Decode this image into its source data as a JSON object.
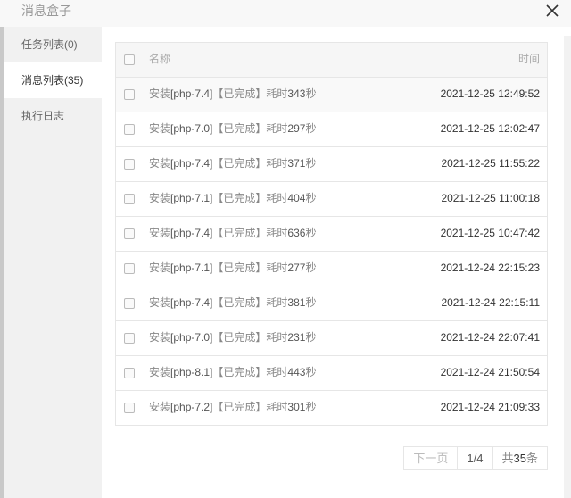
{
  "dialog": {
    "title": "消息盒子",
    "close_icon": "close-icon"
  },
  "sidebar": {
    "items": [
      {
        "label": "任务列表",
        "count": "(0)",
        "active": false
      },
      {
        "label": "消息列表",
        "count": "(35)",
        "active": true
      },
      {
        "label": "执行日志",
        "count": "",
        "active": false
      }
    ]
  },
  "table": {
    "headers": {
      "name": "名称",
      "time": "时间"
    },
    "rows": [
      {
        "prefix": "安装",
        "version": "[php-7.4]",
        "status": "【已完成】",
        "label": "耗时",
        "seconds": "343",
        "unit": "秒",
        "time": "2021-12-25 12:49:52"
      },
      {
        "prefix": "安装",
        "version": "[php-7.0]",
        "status": "【已完成】",
        "label": "耗时",
        "seconds": "297",
        "unit": "秒",
        "time": "2021-12-25 12:02:47"
      },
      {
        "prefix": "安装",
        "version": "[php-7.4]",
        "status": "【已完成】",
        "label": "耗时",
        "seconds": "371",
        "unit": "秒",
        "time": "2021-12-25 11:55:22"
      },
      {
        "prefix": "安装",
        "version": "[php-7.1]",
        "status": "【已完成】",
        "label": "耗时",
        "seconds": "404",
        "unit": "秒",
        "time": "2021-12-25 11:00:18"
      },
      {
        "prefix": "安装",
        "version": "[php-7.4]",
        "status": "【已完成】",
        "label": "耗时",
        "seconds": "636",
        "unit": "秒",
        "time": "2021-12-25 10:47:42"
      },
      {
        "prefix": "安装",
        "version": "[php-7.1]",
        "status": "【已完成】",
        "label": "耗时",
        "seconds": "277",
        "unit": "秒",
        "time": "2021-12-24 22:15:23"
      },
      {
        "prefix": "安装",
        "version": "[php-7.4]",
        "status": "【已完成】",
        "label": "耗时",
        "seconds": "381",
        "unit": "秒",
        "time": "2021-12-24 22:15:11"
      },
      {
        "prefix": "安装",
        "version": "[php-7.0]",
        "status": "【已完成】",
        "label": "耗时",
        "seconds": "231",
        "unit": "秒",
        "time": "2021-12-24 22:07:41"
      },
      {
        "prefix": "安装",
        "version": "[php-8.1]",
        "status": "【已完成】",
        "label": "耗时",
        "seconds": "443",
        "unit": "秒",
        "time": "2021-12-24 21:50:54"
      },
      {
        "prefix": "安装",
        "version": "[php-7.2]",
        "status": "【已完成】",
        "label": "耗时",
        "seconds": "301",
        "unit": "秒",
        "time": "2021-12-24 21:09:33"
      }
    ]
  },
  "pager": {
    "prev_label": "下一页",
    "page": "1/4",
    "total_prefix": "共",
    "total_count": "35",
    "total_suffix": "条"
  }
}
